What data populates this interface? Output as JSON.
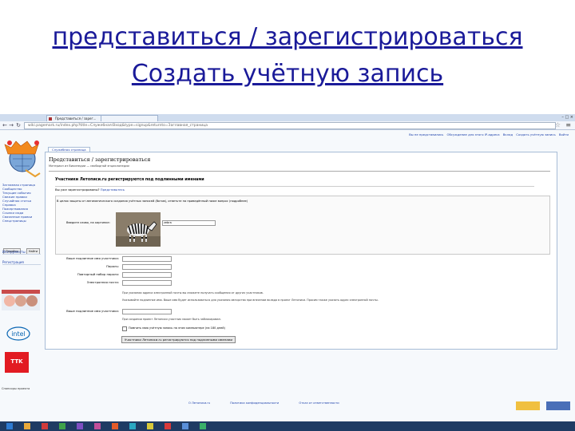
{
  "slide": {
    "title_line1": "представиться / зарегистрироваться",
    "title_line2": "Создать учётную запись"
  },
  "browser": {
    "tabs": [
      {
        "label": "Представиться / зарег..."
      },
      {
        "label": ""
      }
    ],
    "window_controls": "–  □  ×",
    "address": "wiki.pagemark.ru/index.php?title=Служебная:Вход&type=signup&returnto=Заглавная_страница"
  },
  "page": {
    "top_links": [
      "Вы не представились",
      "Обсуждение для этого IP-адреса",
      "Вклад",
      "Создать учётную запись",
      "Войти"
    ],
    "sidebar_links": [
      "Заглавная страница",
      "Сообщество",
      "Текущие события",
      "Свежие правки",
      "Случайная статья",
      "Справка",
      "Пожертвования",
      "Ссылки сюда",
      "Связанные правки",
      "Спецстраницы"
    ],
    "sidebar_buttons": [
      "Перейти",
      "Найти"
    ],
    "sidebar_sections": [
      "Инструменты",
      "Регистрация"
    ],
    "sidebar_footer": "Спонсоры проекта",
    "logo_text": "TTK",
    "content_tab": "Служебная страница",
    "heading": "Представиться / зарегистрироваться",
    "subheading": "Материал из Википедии — свободной энциклопедии",
    "section_title": "Участники Летописи.ru регистрируются под подлинными именами",
    "already": "Вы уже зарегистрированы?",
    "already_link": "Представьтесь",
    "captcha_text": "В целях защиты от автоматического создания учётных записей (ботов), ответьте на приведённый ниже вопрос (подробнее)",
    "captcha_label": "Введите слово, на картинке:",
    "captcha_value": "zebra",
    "fields": [
      {
        "label": "Ваше подлинное имя участника:"
      },
      {
        "label": "Пароль:"
      },
      {
        "label": "Повторный набор пароля:"
      },
      {
        "label": "Электронная почта:"
      }
    ],
    "note1": "При указании адреса электронной почты вы сможете получать сообщения от других участников.",
    "note2": "Указывайте подлинное имя. Ваше имя будет использоваться для указания авторства при внесении вклада в проект Летописи. Просим также указать адрес электронной почты.",
    "real_name_label": "Ваше подлинное имя участника:",
    "note3": "При создании проект Летописи участник может быть заблокирован.",
    "checkbox_label": "Помнить мою учётную запись на этом компьютере (на 180 дней)",
    "submit_label": "Участники Летописи.ru регистрируются под подлинными именами",
    "footer_links": [
      "О Летописи.ru",
      "Политика конфиденциальности",
      "Отказ от ответственности"
    ]
  }
}
